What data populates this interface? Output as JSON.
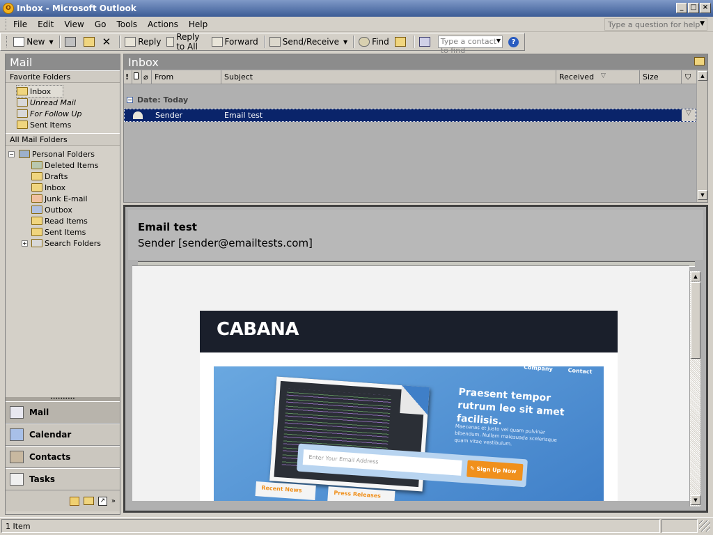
{
  "window": {
    "title": "Inbox - Microsoft Outlook"
  },
  "menu": [
    "File",
    "Edit",
    "View",
    "Go",
    "Tools",
    "Actions",
    "Help"
  ],
  "help_box": {
    "placeholder": "Type a question for help"
  },
  "toolbar": {
    "new_label": "New",
    "reply_label": "Reply",
    "reply_all_label": "Reply to All",
    "forward_label": "Forward",
    "send_receive_label": "Send/Receive",
    "find_label": "Find",
    "contact_placeholder": "Type a contact to find"
  },
  "nav": {
    "title": "Mail",
    "favorites_heading": "Favorite Folders",
    "favorites": [
      "Inbox",
      "Unread Mail",
      "For Follow Up",
      "Sent Items"
    ],
    "all_heading": "All Mail Folders",
    "root": "Personal Folders",
    "folders": [
      "Deleted Items",
      "Drafts",
      "Inbox",
      "Junk E-mail",
      "Outbox",
      "Read Items",
      "Sent Items",
      "Search Folders"
    ],
    "buttons": [
      "Mail",
      "Calendar",
      "Contacts",
      "Tasks"
    ]
  },
  "inbox": {
    "title": "Inbox",
    "columns": {
      "importance": "!",
      "from": "From",
      "subject": "Subject",
      "received": "Received",
      "size": "Size"
    },
    "group_label": "Date: Today",
    "message": {
      "from": "Sender",
      "subject": "Email test"
    }
  },
  "reading": {
    "subject": "Email test",
    "from": "Sender [sender@emailtests.com]"
  },
  "email": {
    "brand": "CABANA",
    "nav_links": [
      "Company",
      "Contact"
    ],
    "hero_heading": "Praesent tempor rutrum leo sit amet facilisis.",
    "hero_text": "Maecenas et justo vel quam pulvinar bibendum. Nullam malesuada scelerisque quam vitae vestibulum.",
    "email_placeholder": "Enter Your Email Address",
    "signup_label": "Sign Up Now",
    "tabs": [
      "Recent News",
      "Press Releases"
    ]
  },
  "status": {
    "items": "1 Item"
  },
  "colors": {
    "titlebar": "#3c5c96",
    "selection": "#0a246a",
    "cabana_header": "#1a1f2b",
    "signup": "#f0901c"
  }
}
